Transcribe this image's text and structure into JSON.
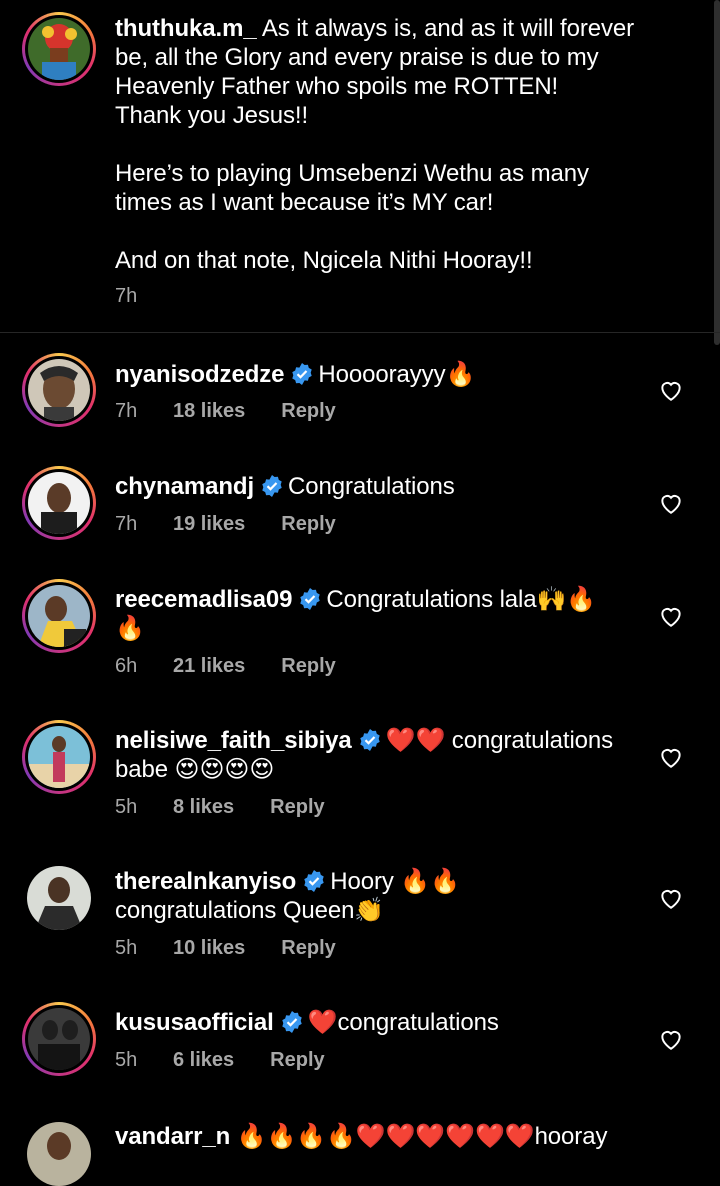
{
  "caption": {
    "username": "thuthuka.m_",
    "text_lines": [
      "As it always is, and as it will forever",
      "be, all the Glory and every praise is due to my",
      "Heavenly Father who spoils me ROTTEN!",
      "Thank you Jesus!!"
    ],
    "text_lines_2": [
      "Here’s to playing Umsebenzi Wethu as many",
      "times as I want because it’s MY car!"
    ],
    "text_lines_3": [
      "And on that note, Ngicela Nithi Hooray!!"
    ],
    "time": "7h"
  },
  "comments": [
    {
      "username": "nyanisodzedze",
      "line1": "Hoooorayyy🔥",
      "line2": "",
      "time": "7h",
      "likes": "18 likes",
      "reply": "Reply"
    },
    {
      "username": "chynamandj",
      "line1": "Congratulations",
      "line2": "",
      "time": "7h",
      "likes": "19 likes",
      "reply": "Reply"
    },
    {
      "username": "reecemadlisa09",
      "line1": "Congratulations lala🙌🔥",
      "line2": "🔥",
      "time": "6h",
      "likes": "21 likes",
      "reply": "Reply"
    },
    {
      "username": "nelisiwe_faith_sibiya",
      "line1": "❤️❤️ congratulations",
      "line2": "babe 😍😍😍😍",
      "time": "5h",
      "likes": "8 likes",
      "reply": "Reply"
    },
    {
      "username": "therealnkanyiso",
      "line1": "Hoory 🔥🔥",
      "line2": "congratulations  Queen👏",
      "time": "5h",
      "likes": "10 likes",
      "reply": "Reply"
    },
    {
      "username": "kususaofficial",
      "line1": "❤️congratulations",
      "line2": "",
      "time": "5h",
      "likes": "6 likes",
      "reply": "Reply"
    },
    {
      "username": "vandarr_n",
      "line1": "🔥🔥🔥🔥❤️❤️❤️❤️❤️❤️hooray",
      "line2": "",
      "time": "",
      "likes": "",
      "reply": ""
    }
  ],
  "colors": {
    "background": "#000000",
    "meta_text": "#a8a8a8",
    "verified_blue": "#3897f0",
    "heart_outline": "#ffffff"
  },
  "icons": {
    "verified": "verified-badge-icon",
    "like": "heart-outline-icon"
  }
}
